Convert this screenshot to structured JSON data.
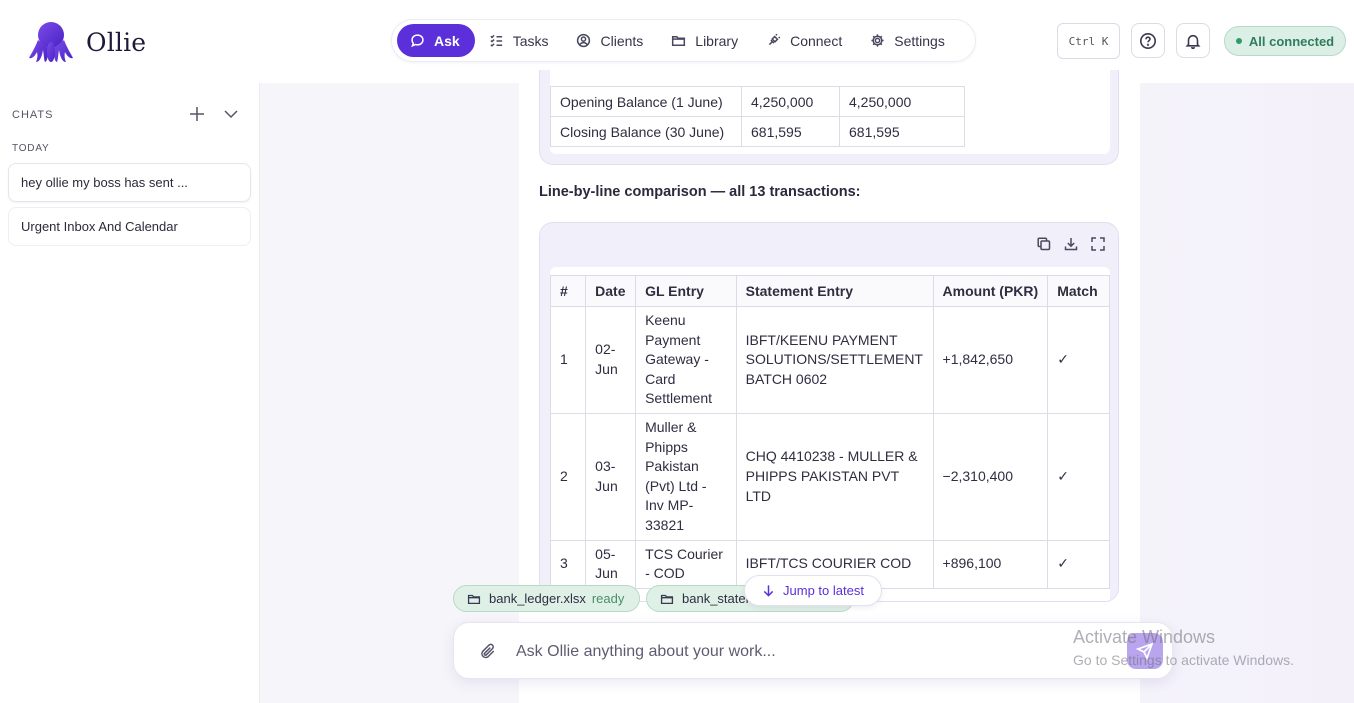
{
  "brand": {
    "name": "Ollie"
  },
  "nav": [
    {
      "label": "Ask",
      "icon": "chat-bubble-icon",
      "active": true
    },
    {
      "label": "Tasks",
      "icon": "checklist-icon"
    },
    {
      "label": "Clients",
      "icon": "user-circle-icon"
    },
    {
      "label": "Library",
      "icon": "folder-icon"
    },
    {
      "label": "Connect",
      "icon": "plug-icon"
    },
    {
      "label": "Settings",
      "icon": "gear-icon"
    }
  ],
  "header": {
    "shortcut": "Ctrl K",
    "status": "All connected",
    "status_color": "#2f7d5a",
    "accent_color": "#5b2fd9"
  },
  "sidebar": {
    "heading": "CHATS",
    "group": "TODAY",
    "chats": [
      {
        "title": "hey ollie my boss has sent ..."
      },
      {
        "title": "Urgent Inbox And Calendar"
      }
    ]
  },
  "balances": [
    {
      "label": "Opening Balance (1 June)",
      "gl": "4,250,000",
      "statement": "4,250,000"
    },
    {
      "label": "Closing Balance (30 June)",
      "gl": "681,595",
      "statement": "681,595"
    }
  ],
  "comparison": {
    "heading": "Line-by-line comparison — all 13 transactions:",
    "columns": [
      "#",
      "Date",
      "GL Entry",
      "Statement Entry",
      "Amount (PKR)",
      "Match"
    ],
    "rows": [
      {
        "num": "1",
        "date": "02-Jun",
        "gl": "Keenu Payment Gateway - Card Settlement",
        "stmt": "IBFT/KEENU PAYMENT SOLUTIONS/SETTLEMENT BATCH 0602",
        "amount": "+1,842,650",
        "match": "✓"
      },
      {
        "num": "2",
        "date": "03-Jun",
        "gl": "Muller & Phipps Pakistan (Pvt) Ltd - Inv MP-33821",
        "stmt": "CHQ 4410238 - MULLER & PHIPPS PAKISTAN PVT LTD",
        "amount": "−2,310,400",
        "match": "✓"
      },
      {
        "num": "3",
        "date": "05-Jun",
        "gl": "TCS Courier - COD",
        "stmt": "IBFT/TCS COURIER COD",
        "amount": "+896,100",
        "match": "✓"
      }
    ]
  },
  "attachments": [
    {
      "name": "bank_ledger.xlsx",
      "status": "ready"
    },
    {
      "name": "bank_statement",
      "status": ""
    }
  ],
  "jump_label": "Jump to latest",
  "composer": {
    "placeholder": "Ask Ollie anything about your work..."
  },
  "watermark": {
    "line1": "Activate Windows",
    "line2": "Go to Settings to activate Windows."
  }
}
